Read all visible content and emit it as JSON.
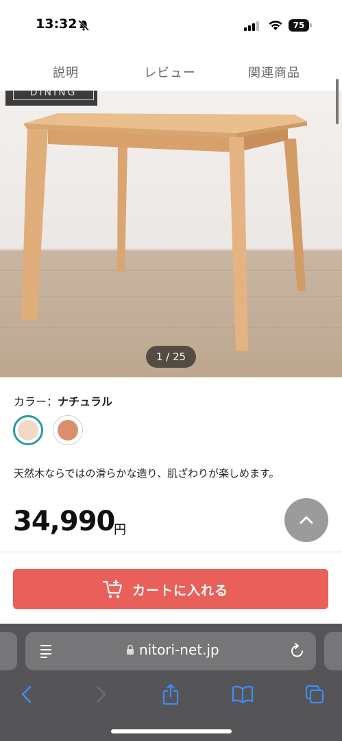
{
  "status_bar": {
    "time": "13:32",
    "battery": "75"
  },
  "tabs": [
    {
      "label": "説明"
    },
    {
      "label": "レビュー"
    },
    {
      "label": "関連商品"
    }
  ],
  "gallery": {
    "tag": "DINING",
    "counter": "1 / 25"
  },
  "product": {
    "color_label": "カラー：",
    "color_value": "ナチュラル",
    "swatches": [
      {
        "name": "natural",
        "color": "#f2d9c6",
        "selected": true
      },
      {
        "name": "brown",
        "color": "#d98e6c",
        "selected": false
      }
    ],
    "description": "天然木ならではの滑らかな造り、肌ざわりが楽しめます。",
    "price": "34,990",
    "currency": "円"
  },
  "cart_button": {
    "label": "カートに入れる",
    "color": "#e9605a"
  },
  "browser": {
    "url": "nitori-net.jp"
  },
  "colors": {
    "accent": "#2a9d9a",
    "cart": "#e9605a"
  }
}
